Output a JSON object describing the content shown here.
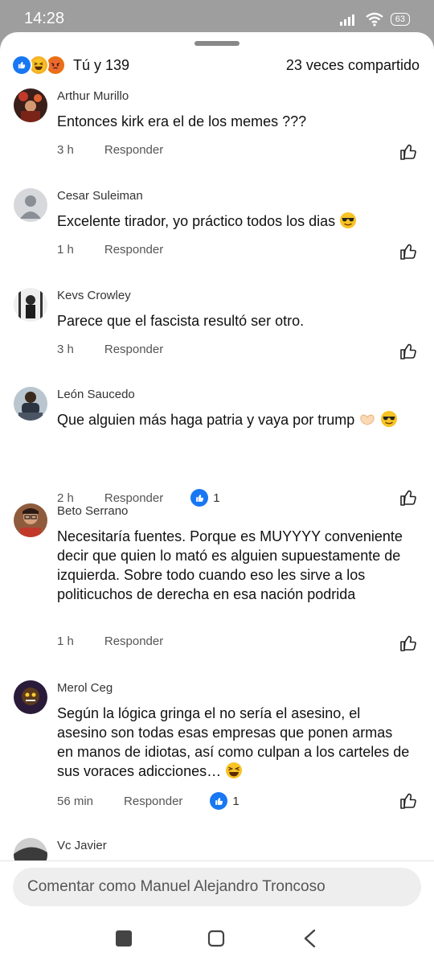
{
  "status_bar": {
    "time": "14:28",
    "battery": "63"
  },
  "summary": {
    "reactions_text": "Tú y 139",
    "shares_text": "23 veces compartido"
  },
  "comments": [
    {
      "author": "Arthur Murillo",
      "text": "Entonces kirk era el de los memes ???",
      "time": "3 h",
      "reply": "Responder"
    },
    {
      "author": "Cesar Suleiman",
      "text": "Excelente tirador, yo práctico todos los dias",
      "time": "1 h",
      "reply": "Responder"
    },
    {
      "author": "Kevs Crowley",
      "text": "Parece que el fascista resultó ser otro.",
      "time": "3 h",
      "reply": "Responder"
    },
    {
      "author": "León Saucedo",
      "text": "Que alguien más haga patria y vaya por trump",
      "time": "2 h",
      "reply": "Responder",
      "likes": "1"
    },
    {
      "author": "Beto Serrano",
      "text": "Necesitaría fuentes. Porque es MUYYYY conveniente decir que quien lo mató es alguien supuestamente de izquierda. Sobre todo cuando eso les sirve a los politicuchos de derecha en esa nación podrida",
      "time": "1 h",
      "reply": "Responder"
    },
    {
      "author": "Merol Ceg",
      "text": "Según la lógica gringa el no sería el asesino, el asesino son todas esas empresas que ponen armas en manos de idiotas, así como culpan a los carteles de sus voraces adicciones…",
      "time": "56 min",
      "reply": "Responder",
      "likes": "1"
    },
    {
      "author": "Vc Javier"
    }
  ],
  "comment_input": {
    "placeholder": "Comentar como Manuel Alejandro Troncoso"
  },
  "icons": {
    "signal": "signal-icon",
    "wifi": "wifi-icon",
    "battery": "battery-icon",
    "like_reaction": "like-reaction-icon",
    "haha_reaction": "haha-reaction-icon",
    "angry_reaction": "angry-reaction-icon",
    "like_button": "thumbs-up-icon",
    "recents": "square-icon",
    "home": "home-icon",
    "back": "back-icon"
  },
  "colors": {
    "accent": "#1877f2",
    "background": "#ffffff",
    "input_bg": "#eeeeee"
  }
}
